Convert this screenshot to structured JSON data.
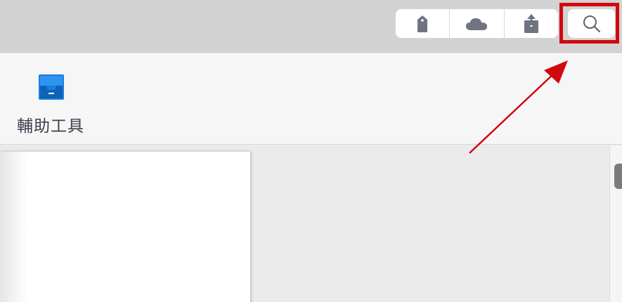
{
  "toolbar": {
    "buttons": [
      {
        "name": "tag-button",
        "icon": "tag-icon"
      },
      {
        "name": "cloud-button",
        "icon": "cloud-icon"
      },
      {
        "name": "share-button",
        "icon": "share-icon"
      }
    ],
    "search": {
      "icon": "search-icon"
    },
    "icon_color": "#6f7382"
  },
  "ribbon": {
    "items": [
      {
        "label": "輔助工具",
        "icon": "accessibility-tools-icon",
        "icon_color": "#1a7ee0"
      }
    ]
  },
  "annotation": {
    "highlight_color": "#d0090f",
    "target": "search-button"
  }
}
